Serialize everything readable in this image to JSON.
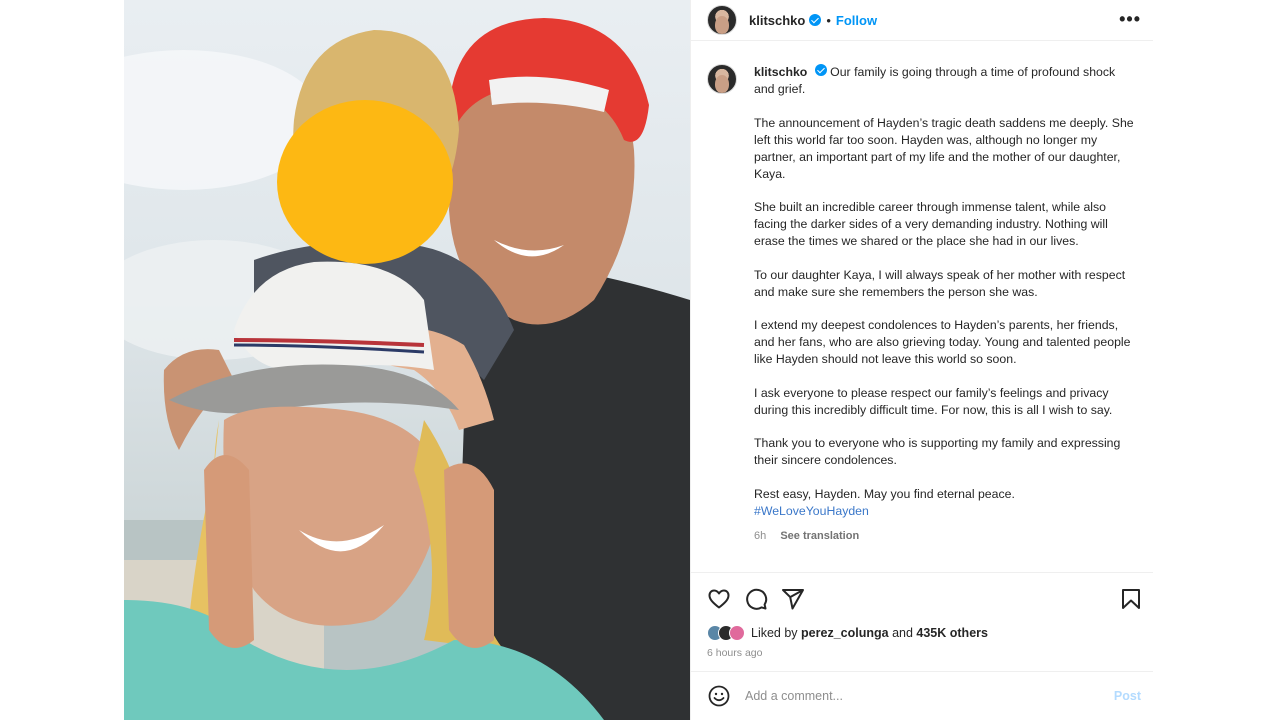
{
  "post": {
    "author": "klitschko",
    "follow_label": "Follow",
    "separator": "•",
    "more_label": "•••",
    "photo_alt": "Selfie of Wladimir Klitschko, Hayden Panettiere and their daughter on a beach"
  },
  "caption": {
    "author": "klitschko",
    "paragraphs": [
      "Our family is going through a time of profound shock and grief.",
      "The announcement of Hayden’s tragic death saddens me deeply. She left this world far too soon. Hayden was, although no longer my partner, an important part of my life and the mother of our daughter, Kaya.",
      "She built an incredible career through immense talent, while also facing the darker sides of a very demanding industry. Nothing will erase the times we shared or the place she had in our lives.",
      "To our daughter Kaya, I will always speak of her mother with respect and make sure she remembers the person she was.",
      "I extend my deepest condolences to Hayden’s parents, her friends, and her fans, who are also grieving today. Young and talented people like Hayden should not leave this world so soon.",
      "I ask everyone to please respect our family’s feelings and privacy during this incredibly difficult time. For now, this is all I wish to say.",
      "Thank you to everyone who is supporting my family and expressing their sincere condolences.",
      "Rest easy, Hayden. May you find eternal peace."
    ],
    "hashtag": "#WeLoveYouHayden",
    "time": "6h",
    "see_translation": "See translation"
  },
  "actions": {
    "liked_by_prefix": "Liked by",
    "liked_by_user": "perez_colunga",
    "and_label": "and",
    "others": "435K others",
    "time_ago": "6 hours ago"
  },
  "comment": {
    "placeholder": "Add a comment...",
    "post_label": "Post"
  },
  "icons": {
    "like": "heart-icon",
    "comment": "comment-icon",
    "share": "share-icon",
    "save": "bookmark-icon",
    "emoji": "emoji-icon"
  },
  "colors": {
    "accent": "#0095f6",
    "link": "#3a77c9",
    "post_disabled": "#b3dbff",
    "blur_circle": "#fdb813"
  }
}
